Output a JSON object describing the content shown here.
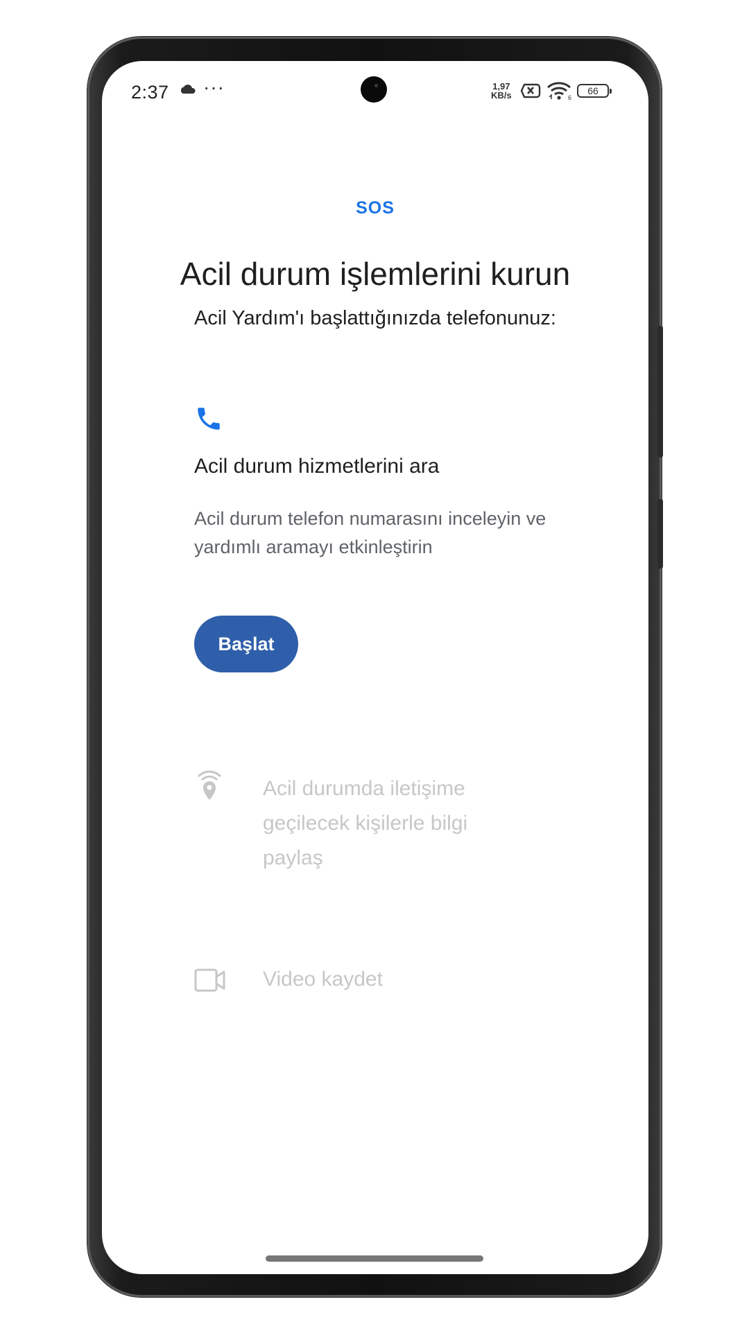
{
  "status_bar": {
    "time": "2:37",
    "cloud_icon": "cloud-icon",
    "more_indicator": "···",
    "net_speed_value": "1,97",
    "net_speed_unit": "KB/s",
    "sim_icon": "sim-x-icon",
    "wifi_icon": "wifi-icon",
    "wifi_label": "6",
    "battery_level": "66"
  },
  "header": {
    "sos_label": "SOS",
    "title": "Acil durum işlemlerini kurun",
    "subtitle": "Acil Yardım'ı başlattığınızda telefonunuz:"
  },
  "steps": [
    {
      "icon": "phone-icon",
      "title": "Acil durum hizmetlerini ara",
      "description": "Acil durum telefon numarasını inceleyin ve yardımlı aramayı etkinleştirin",
      "button_label": "Başlat"
    },
    {
      "icon": "location-share-icon",
      "title": "Acil durumda iletişime geçilecek kişilerle bilgi paylaş"
    },
    {
      "icon": "video-icon",
      "title": "Video kaydet"
    }
  ],
  "colors": {
    "accent": "#1a73e8",
    "button": "#2f5faa",
    "disabled_text": "#c7c7c7",
    "secondary_text": "#5f6368"
  }
}
